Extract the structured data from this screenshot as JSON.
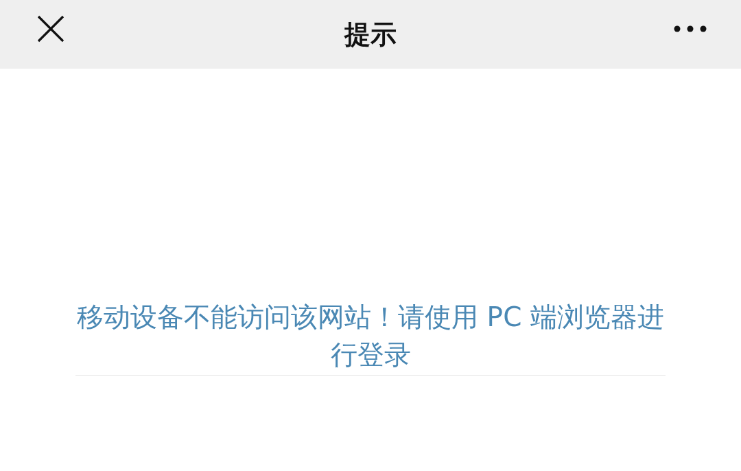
{
  "header": {
    "title": "提示"
  },
  "message": "移动设备不能访问该网站！请使用 PC 端浏览器进行登录"
}
